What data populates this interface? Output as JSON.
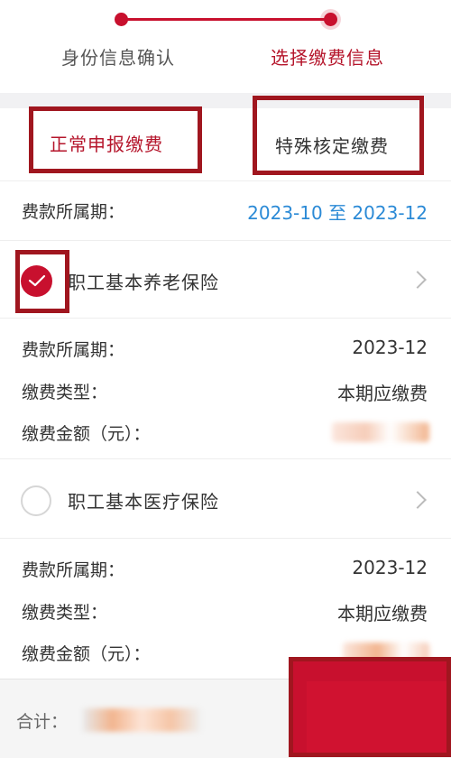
{
  "stepper": {
    "step1_label": "身份信息确认",
    "step2_label": "选择缴费信息"
  },
  "tabs": {
    "normal_label": "正常申报缴费",
    "special_label": "特殊核定缴费"
  },
  "period": {
    "label": "费款所属期：",
    "value": "2023-10 至 2023-12"
  },
  "items": [
    {
      "name": "职工基本养老保险",
      "checked": true,
      "period_label": "费款所属期：",
      "period_value": "2023-12",
      "type_label": "缴费类型：",
      "type_value": "本期应缴费",
      "amount_label": "缴费金额（元）："
    },
    {
      "name": "职工基本医疗保险",
      "checked": false,
      "period_label": "费款所属期：",
      "period_value": "2023-12",
      "type_label": "缴费类型：",
      "type_value": "本期应缴费",
      "amount_label": "缴费金额（元）："
    }
  ],
  "footer": {
    "total_label": "合计："
  },
  "colors": {
    "accent": "#c8102e",
    "highlight_box": "#a0161f",
    "link_blue": "#2b8ad6"
  }
}
